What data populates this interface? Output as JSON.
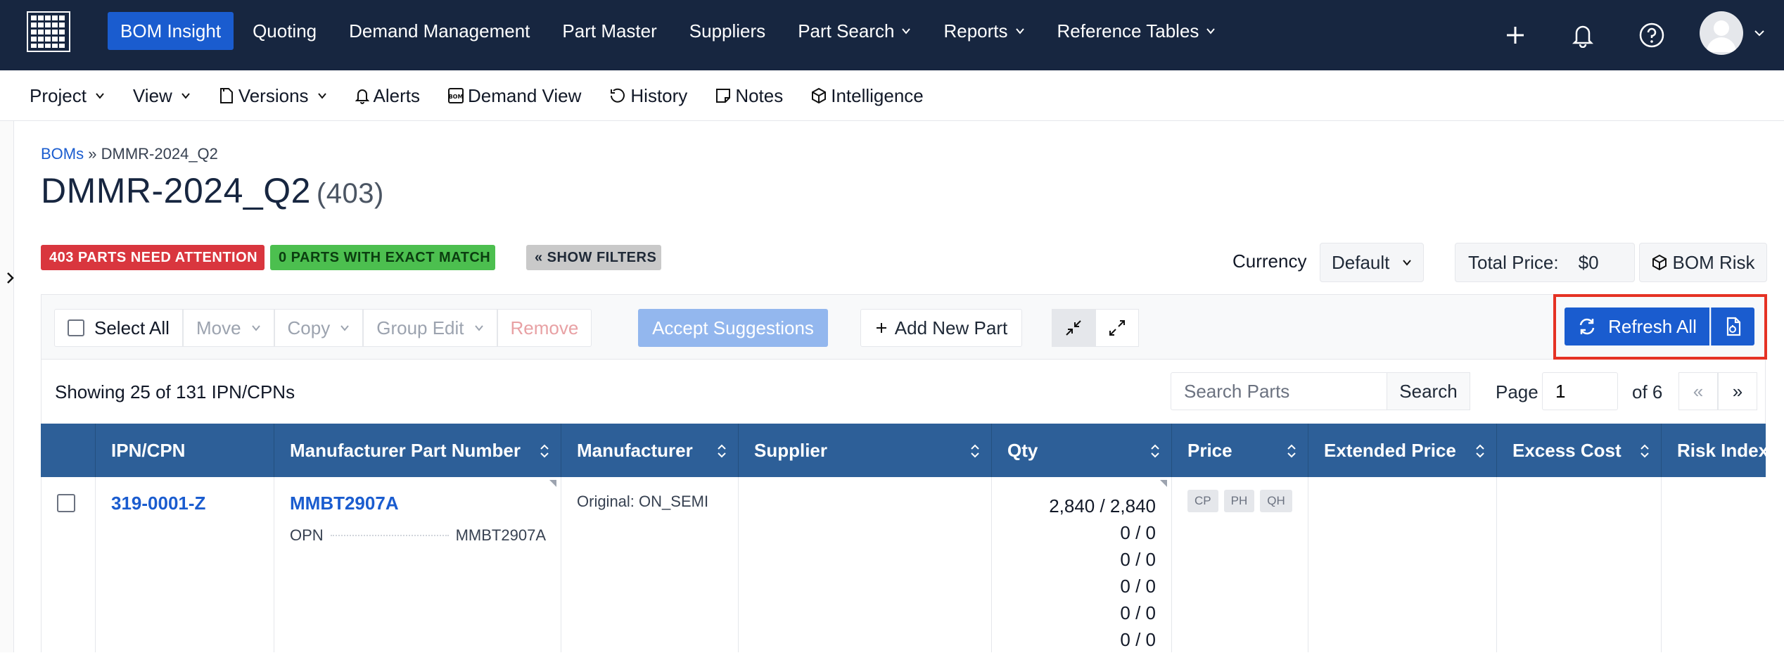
{
  "topnav": {
    "items": [
      {
        "label": "BOM Insight",
        "active": true
      },
      {
        "label": "Quoting"
      },
      {
        "label": "Demand Management"
      },
      {
        "label": "Part Master"
      },
      {
        "label": "Suppliers"
      },
      {
        "label": "Part Search",
        "dropdown": true
      },
      {
        "label": "Reports",
        "dropdown": true
      },
      {
        "label": "Reference Tables",
        "dropdown": true
      }
    ],
    "icons": [
      "plus-icon",
      "bell-icon",
      "help-icon",
      "avatar"
    ]
  },
  "subnav": {
    "project": "Project",
    "view": "View",
    "versions": "Versions",
    "alerts": "Alerts",
    "demand_view": "Demand View",
    "history": "History",
    "notes": "Notes",
    "intelligence": "Intelligence"
  },
  "breadcrumb": {
    "root": "BOMs",
    "separator": "»",
    "current": "DMMR-2024_Q2"
  },
  "title": {
    "name": "DMMR-2024_Q2",
    "count": "(403)"
  },
  "badges": {
    "attention": "403 PARTS NEED ATTENTION",
    "exact": "0 PARTS WITH EXACT MATCH",
    "filters": "« SHOW FILTERS"
  },
  "summary": {
    "currency_label": "Currency",
    "currency_value": "Default",
    "total_label": "Total Price:",
    "total_value": "$0",
    "bom_risk": "BOM Risk"
  },
  "toolbar": {
    "select_all": "Select All",
    "move": "Move",
    "copy": "Copy",
    "group_edit": "Group Edit",
    "remove": "Remove",
    "accept": "Accept Suggestions",
    "add_new": "Add New Part",
    "refresh_all": "Refresh All"
  },
  "listing": {
    "showing": "Showing 25 of 131 IPN/CPNs",
    "search_placeholder": "Search Parts",
    "search_button": "Search",
    "page_label": "Page",
    "page_value": "1",
    "of_label": "of 6",
    "prev": "«",
    "next": "»"
  },
  "table": {
    "columns": [
      "IPN/CPN",
      "Manufacturer Part Number",
      "Manufacturer",
      "Supplier",
      "Qty",
      "Price",
      "Extended Price",
      "Excess Cost",
      "Risk Index"
    ],
    "rows": [
      {
        "ipn": "319-0001-Z",
        "mpn": "MMBT2907A",
        "opn_label": "OPN",
        "opn_value": "MMBT2907A",
        "manufacturer": "Original: ON_SEMI",
        "qty": [
          "2,840 / 2,840",
          "0 / 0",
          "0 / 0",
          "0 / 0",
          "0 / 0",
          "0 / 0"
        ],
        "price_tags": [
          "CP",
          "PH",
          "QH"
        ]
      }
    ]
  },
  "colors": {
    "nav_bg": "#172640",
    "accent": "#1a5ccf",
    "table_header": "#2d5f98",
    "danger": "#d9363e",
    "success": "#4cbf4f",
    "highlight": "#e53224"
  }
}
